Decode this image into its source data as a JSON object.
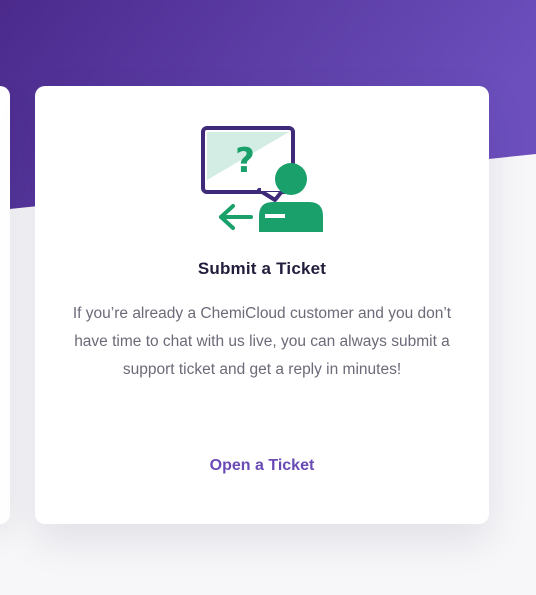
{
  "colors": {
    "purple_dark": "#4b2a8c",
    "purple_light": "#6c4fbd",
    "green": "#19a06b",
    "title": "#231d3d",
    "text": "#6c6a78",
    "link": "#6a4bb6"
  },
  "card": {
    "icon": "submit-ticket-icon",
    "title": "Submit a Ticket",
    "description": "If you’re already a ChemiCloud customer and you don’t have time to chat with us live, you can always submit a support ticket and get a reply in minutes!",
    "link_label": "Open a Ticket"
  }
}
